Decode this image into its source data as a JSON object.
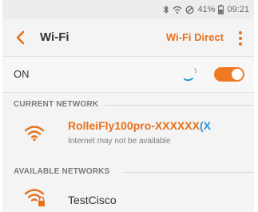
{
  "status_bar": {
    "battery": "41%",
    "time": "09:21",
    "icons": [
      "bluetooth-icon",
      "wifi-status-icon",
      "no-signal-icon",
      "battery-icon"
    ]
  },
  "app_bar": {
    "title": "Wi-Fi",
    "wifi_direct_label": "Wi-Fi Direct",
    "icons": [
      "back-arrow-icon",
      "more-options-icon"
    ]
  },
  "wifi_toggle": {
    "label": "ON",
    "state": "on"
  },
  "current_network": {
    "section_header": "CURRENT NETWORK",
    "name": "RolleiFly100pro-XXXXXX",
    "name_tail": "(X",
    "status": "Internet may not be available"
  },
  "available_networks": {
    "section_header": "AVAILABLE NETWORKS",
    "items": [
      {
        "name": "TestCisco",
        "secured": true
      }
    ]
  },
  "colors": {
    "accent": "#e8701a",
    "toggle": "#ef7a22",
    "link_blue": "#2a9ad8"
  }
}
